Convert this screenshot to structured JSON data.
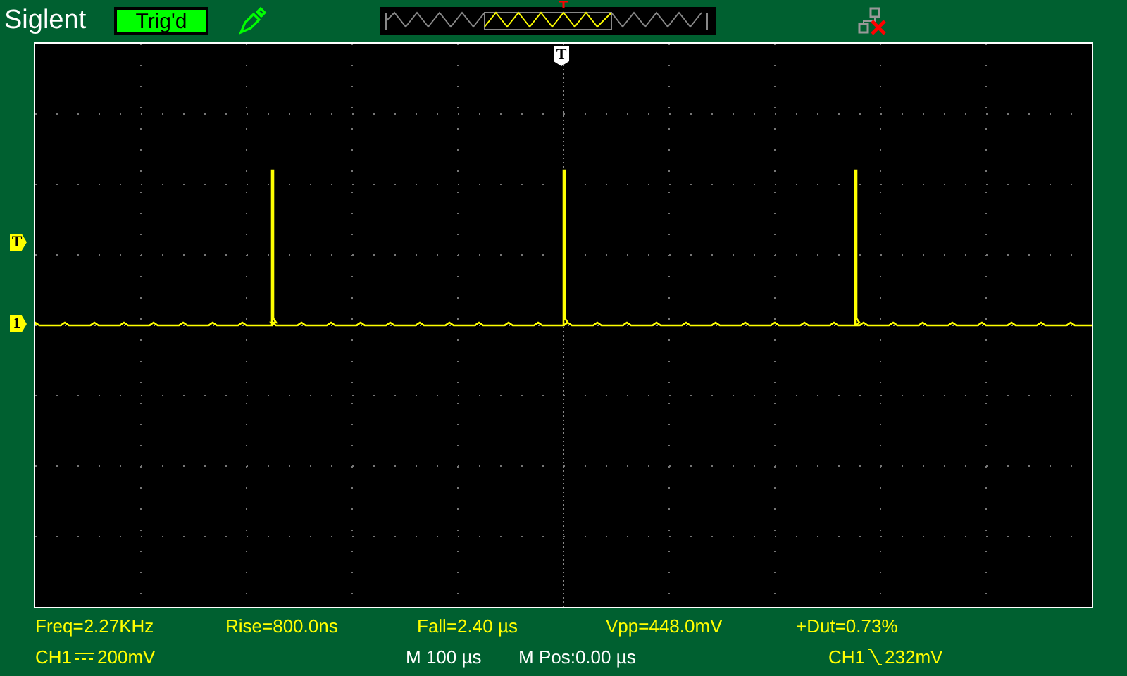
{
  "header": {
    "brand": "Siglent",
    "trigger_status": "Trig'd"
  },
  "markers": {
    "trigger_position": "T",
    "trigger_level": "T",
    "channel": "1"
  },
  "measurements": [
    {
      "label": "Freq=2.27KHz"
    },
    {
      "label": "Rise=800.0ns"
    },
    {
      "label": "Fall=2.40 µs"
    },
    {
      "label": "Vpp=448.0mV"
    },
    {
      "label": "+Dut=0.73%"
    }
  ],
  "status": {
    "channel": "CH1",
    "scale": "200mV",
    "timebase": "M 100 µs",
    "position": "M Pos:0.00 µs",
    "trigger_source": "CH1",
    "trigger_level": "232mV"
  }
}
